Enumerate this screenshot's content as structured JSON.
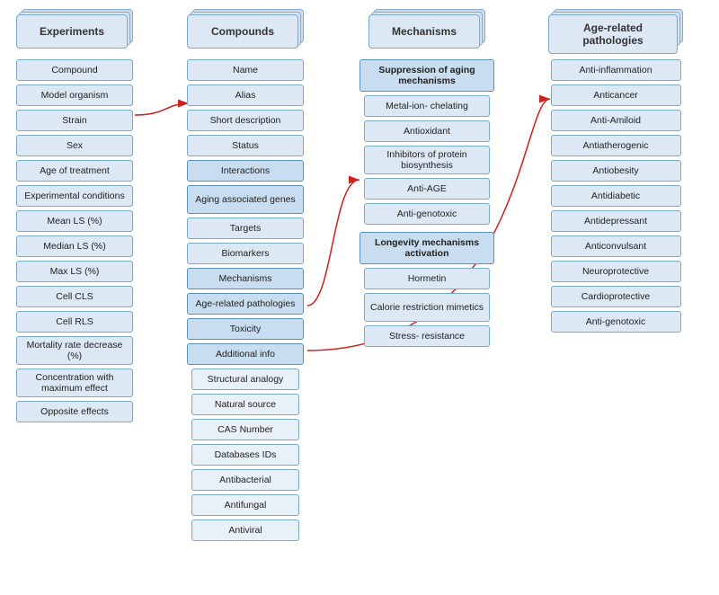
{
  "columns": {
    "experiments": {
      "header": "Experiments",
      "items": [
        "Compound",
        "Model organism",
        "Strain",
        "Sex",
        "Age of treatment",
        "Experimental conditions",
        "Mean LS (%)",
        "Median LS (%)",
        "Max LS (%)",
        "Cell CLS",
        "Cell RLS",
        "Mortality rate decrease (%)",
        "Concentration with maximum effect",
        "Opposite effects"
      ]
    },
    "compounds": {
      "header": "Compounds",
      "items": [
        "Name",
        "Alias",
        "Short description",
        "Status",
        "Interactions",
        "Aging associated genes",
        "Targets",
        "Biomarkers",
        "Mechanisms",
        "Age-related pathologies",
        "Toxicity",
        "Additional info"
      ],
      "sub_items": [
        "Structural analogy",
        "Natural source",
        "CAS Number",
        "Databases IDs",
        "Antibacterial",
        "Antifungal",
        "Antiviral"
      ]
    },
    "mechanisms": {
      "header": "Mechanisms",
      "suppression_header": "Suppression of aging mechanisms",
      "suppression_items": [
        "Metal-ion- chelating",
        "Antioxidant",
        "Inhibitors of protein biosynthesis",
        "Anti-AGE",
        "Anti-genotoxic"
      ],
      "longevity_header": "Longevity mechanisms activation",
      "longevity_items": [
        "Hormetin",
        "Calorie restriction mimetics",
        "Stress- resistance"
      ]
    },
    "pathologies": {
      "header": "Age-related pathologies",
      "items": [
        "Anti-inflammation",
        "Anticancer",
        "Anti-Amiloid",
        "Antiatherogenic",
        "Antiobesity",
        "Antidiabetic",
        "Antidepressant",
        "Anticonvulsant",
        "Neuroprotective",
        "Cardioprotective",
        "Anti-genotoxic"
      ]
    }
  },
  "arrow_color": "#cc2222"
}
